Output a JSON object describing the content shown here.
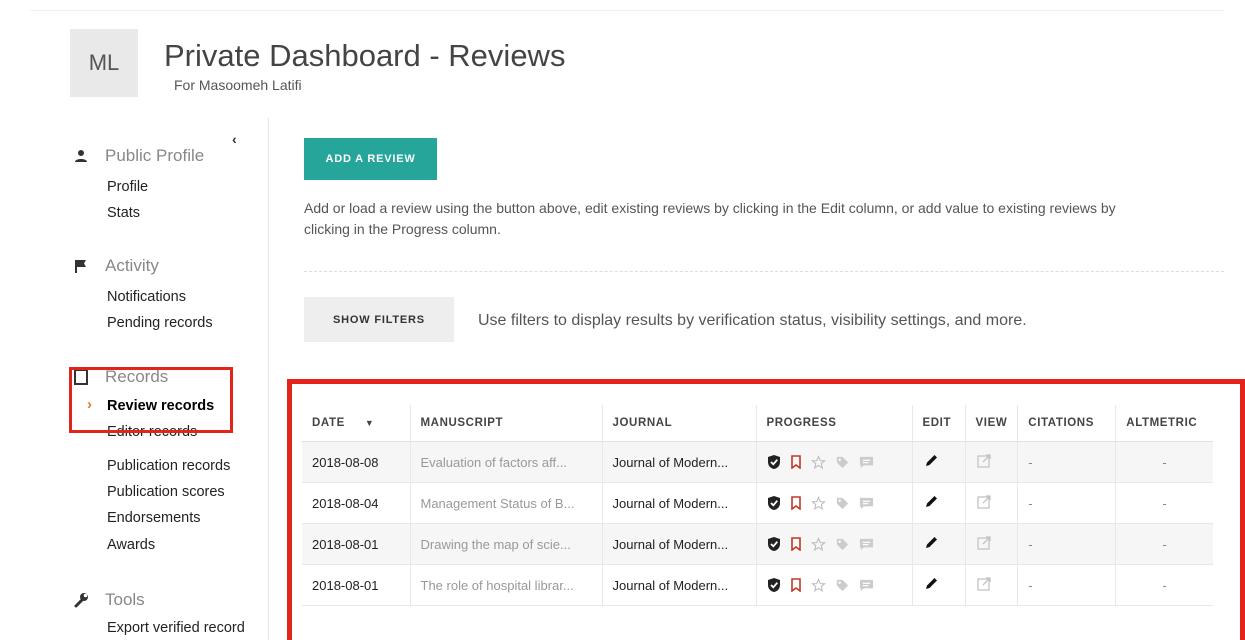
{
  "header": {
    "avatar_initials": "ML",
    "title": "Private Dashboard - Reviews",
    "subtitle": "For Masoomeh Latifi"
  },
  "sidebar": {
    "collapse_icon": "chevron-left-icon",
    "sections": [
      {
        "icon": "person-icon",
        "label": "Public Profile",
        "items": [
          "Profile",
          "Stats"
        ]
      },
      {
        "icon": "flag-icon",
        "label": "Activity",
        "items": [
          "Notifications",
          "Pending records"
        ]
      },
      {
        "icon": "document-icon",
        "label": "Records",
        "items": [
          "Review records",
          "Editor records",
          "Publication records",
          "Publication scores",
          "Endorsements",
          "Awards"
        ]
      },
      {
        "icon": "wrench-icon",
        "label": "Tools",
        "items": [
          "Export verified record"
        ]
      }
    ],
    "active_item": "Review records"
  },
  "main": {
    "add_button": "ADD A REVIEW",
    "help_text": "Add or load a review using the button above, edit existing reviews by clicking in the Edit column, or add value to existing reviews by clicking in the Progress column.",
    "filter_button": "SHOW FILTERS",
    "filter_hint": "Use filters to display results by verification status, visibility settings, and more."
  },
  "table": {
    "columns": [
      "DATE",
      "MANUSCRIPT",
      "JOURNAL",
      "PROGRESS",
      "EDIT",
      "VIEW",
      "CITATIONS",
      "ALTMETRIC"
    ],
    "sort_indicator": "▼",
    "rows": [
      {
        "date": "2018-08-08",
        "manuscript": "Evaluation of factors aff...",
        "journal": "Journal of Modern...",
        "citations": "-",
        "altmetric": "-"
      },
      {
        "date": "2018-08-04",
        "manuscript": "Management Status of B...",
        "journal": "Journal of Modern...",
        "citations": "-",
        "altmetric": "-"
      },
      {
        "date": "2018-08-01",
        "manuscript": "Drawing the map of scie...",
        "journal": "Journal of Modern...",
        "citations": "-",
        "altmetric": "-"
      },
      {
        "date": "2018-08-01",
        "manuscript": "The role of hospital librar...",
        "journal": "Journal of Modern...",
        "citations": "-",
        "altmetric": "-"
      }
    ],
    "progress_icons": [
      "verified-shield-icon",
      "bookmark-icon",
      "star-icon",
      "tag-icon",
      "comment-icon"
    ],
    "colors": {
      "shield": "#222222",
      "bookmark": "#c0392b",
      "muted": "#bbbbbb",
      "accent": "#26a69a",
      "highlight": "#e3241b"
    }
  }
}
